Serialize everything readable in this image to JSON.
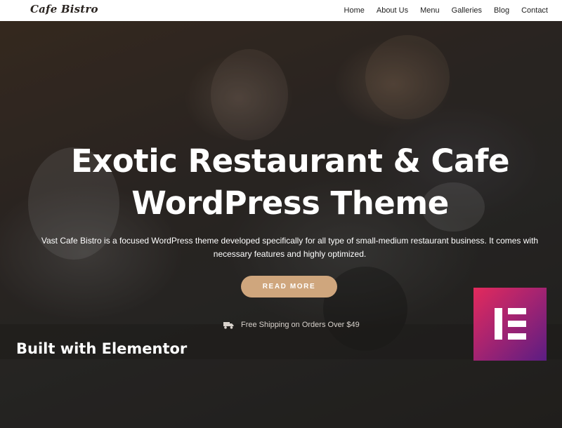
{
  "header": {
    "logo": "Cafe Bistro",
    "nav": [
      "Home",
      "About Us",
      "Menu",
      "Galleries",
      "Blog",
      "Contact"
    ]
  },
  "hero": {
    "title_line1": "Exotic Restaurant & Cafe",
    "title_line2": "WordPress Theme",
    "description": "Vast Cafe Bistro is a focused WordPress theme developed specifically for all type of small-medium restaurant business. It comes with necessary features and highly optimized.",
    "button": "READ MORE",
    "shipping": "Free Shipping on Orders Over $49"
  },
  "badge": {
    "caption": "Built with Elementor",
    "icon": "elementor-logo-icon"
  },
  "colors": {
    "button": "#cfa67d",
    "badge_from": "#e32a5c",
    "badge_to": "#5b1d83"
  }
}
